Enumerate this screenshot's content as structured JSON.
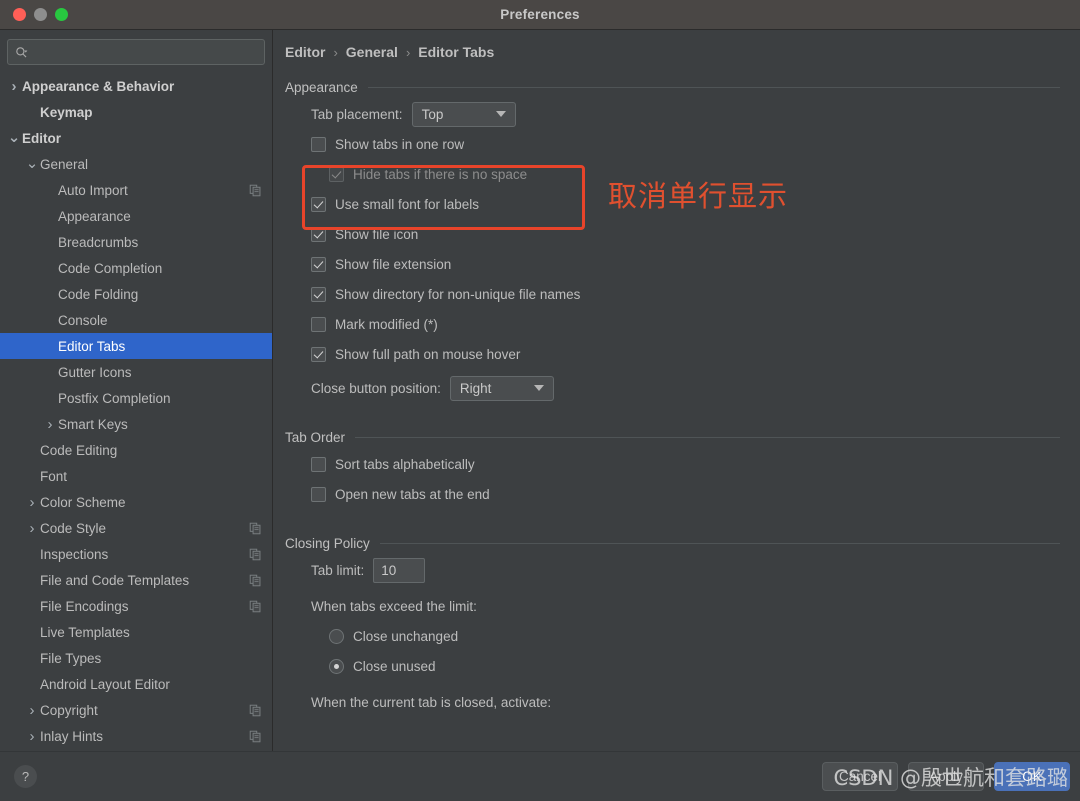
{
  "window": {
    "title": "Preferences",
    "controls": [
      "close",
      "minimize",
      "zoom"
    ]
  },
  "sidebar": {
    "search": {
      "value": "",
      "placeholder": ""
    },
    "items": [
      {
        "label": "Appearance & Behavior",
        "indent": 0,
        "twisty": "collapsed",
        "bold": true,
        "selected": false,
        "copy": false
      },
      {
        "label": "Keymap",
        "indent": 1,
        "twisty": "none",
        "bold": true,
        "selected": false,
        "copy": false
      },
      {
        "label": "Editor",
        "indent": 0,
        "twisty": "expanded",
        "bold": true,
        "selected": false,
        "copy": false
      },
      {
        "label": "General",
        "indent": 1,
        "twisty": "expanded",
        "bold": false,
        "selected": false,
        "copy": false
      },
      {
        "label": "Auto Import",
        "indent": 2,
        "twisty": "none",
        "bold": false,
        "selected": false,
        "copy": true
      },
      {
        "label": "Appearance",
        "indent": 2,
        "twisty": "none",
        "bold": false,
        "selected": false,
        "copy": false
      },
      {
        "label": "Breadcrumbs",
        "indent": 2,
        "twisty": "none",
        "bold": false,
        "selected": false,
        "copy": false
      },
      {
        "label": "Code Completion",
        "indent": 2,
        "twisty": "none",
        "bold": false,
        "selected": false,
        "copy": false
      },
      {
        "label": "Code Folding",
        "indent": 2,
        "twisty": "none",
        "bold": false,
        "selected": false,
        "copy": false
      },
      {
        "label": "Console",
        "indent": 2,
        "twisty": "none",
        "bold": false,
        "selected": false,
        "copy": false
      },
      {
        "label": "Editor Tabs",
        "indent": 2,
        "twisty": "none",
        "bold": false,
        "selected": true,
        "copy": false
      },
      {
        "label": "Gutter Icons",
        "indent": 2,
        "twisty": "none",
        "bold": false,
        "selected": false,
        "copy": false
      },
      {
        "label": "Postfix Completion",
        "indent": 2,
        "twisty": "none",
        "bold": false,
        "selected": false,
        "copy": false
      },
      {
        "label": "Smart Keys",
        "indent": 2,
        "twisty": "collapsed",
        "bold": false,
        "selected": false,
        "copy": false
      },
      {
        "label": "Code Editing",
        "indent": 1,
        "twisty": "none",
        "bold": false,
        "selected": false,
        "copy": false
      },
      {
        "label": "Font",
        "indent": 1,
        "twisty": "none",
        "bold": false,
        "selected": false,
        "copy": false
      },
      {
        "label": "Color Scheme",
        "indent": 1,
        "twisty": "collapsed",
        "bold": false,
        "selected": false,
        "copy": false
      },
      {
        "label": "Code Style",
        "indent": 1,
        "twisty": "collapsed",
        "bold": false,
        "selected": false,
        "copy": true
      },
      {
        "label": "Inspections",
        "indent": 1,
        "twisty": "none",
        "bold": false,
        "selected": false,
        "copy": true
      },
      {
        "label": "File and Code Templates",
        "indent": 1,
        "twisty": "none",
        "bold": false,
        "selected": false,
        "copy": true
      },
      {
        "label": "File Encodings",
        "indent": 1,
        "twisty": "none",
        "bold": false,
        "selected": false,
        "copy": true
      },
      {
        "label": "Live Templates",
        "indent": 1,
        "twisty": "none",
        "bold": false,
        "selected": false,
        "copy": false
      },
      {
        "label": "File Types",
        "indent": 1,
        "twisty": "none",
        "bold": false,
        "selected": false,
        "copy": false
      },
      {
        "label": "Android Layout Editor",
        "indent": 1,
        "twisty": "none",
        "bold": false,
        "selected": false,
        "copy": false
      },
      {
        "label": "Copyright",
        "indent": 1,
        "twisty": "collapsed",
        "bold": false,
        "selected": false,
        "copy": true
      },
      {
        "label": "Inlay Hints",
        "indent": 1,
        "twisty": "collapsed",
        "bold": false,
        "selected": false,
        "copy": true
      }
    ]
  },
  "content": {
    "breadcrumb": {
      "part1": "Editor",
      "part2": "General",
      "part3": "Editor Tabs",
      "separator": "›"
    },
    "appearance": {
      "title": "Appearance",
      "tab_placement": {
        "label": "Tab placement:",
        "value": "Top"
      },
      "show_tabs_one_row": {
        "label": "Show tabs in one row",
        "checked": false
      },
      "hide_tabs_no_space": {
        "label": "Hide tabs if there is no space",
        "checked": true,
        "disabled": true
      },
      "use_small_font": {
        "label": "Use small font for labels",
        "checked": true
      },
      "show_file_icon": {
        "label": "Show file icon",
        "checked": true
      },
      "show_file_extension": {
        "label": "Show file extension",
        "checked": true
      },
      "show_directory": {
        "label": "Show directory for non-unique file names",
        "checked": true
      },
      "mark_modified": {
        "label": "Mark modified (*)",
        "checked": false
      },
      "show_full_path": {
        "label": "Show full path on mouse hover",
        "checked": true
      },
      "close_button_position": {
        "label": "Close button position:",
        "value": "Right"
      }
    },
    "tab_order": {
      "title": "Tab Order",
      "sort_alphabetically": {
        "label": "Sort tabs alphabetically",
        "checked": false
      },
      "open_new_at_end": {
        "label": "Open new tabs at the end",
        "checked": false
      }
    },
    "closing_policy": {
      "title": "Closing Policy",
      "tab_limit": {
        "label": "Tab limit:",
        "value": "10"
      },
      "when_exceed_label": "When tabs exceed the limit:",
      "close_unchanged": {
        "label": "Close unchanged",
        "selected": false
      },
      "close_unused": {
        "label": "Close unused",
        "selected": true
      },
      "when_closed_label": "When the current tab is closed, activate:"
    }
  },
  "annotation": {
    "text": "取消单行显示",
    "color": "#e0502f"
  },
  "footer": {
    "help": "?",
    "cancel": "Cancel",
    "apply": "Apply",
    "ok": "OK"
  },
  "watermark": {
    "text": "CSDN @殷世航和套路璐"
  },
  "colors": {
    "window_bg": "#3c3f41",
    "titlebar_bg": "#4a4745",
    "selection_blue": "#2f65ca",
    "primary_button": "#4a71b8",
    "annotation_red": "#e8442a"
  }
}
